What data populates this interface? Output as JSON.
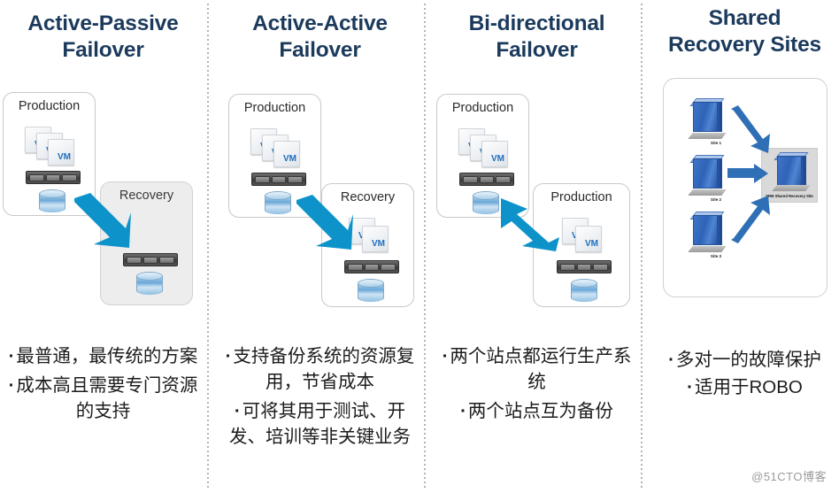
{
  "columns": [
    {
      "id": "active-passive",
      "title_line1": "Active-Passive",
      "title_line2": "Failover",
      "boxes": [
        {
          "label": "Production"
        },
        {
          "label": "Recovery"
        }
      ],
      "arrow": "single-down-right",
      "bullets": [
        "最普通，最传统的方案",
        "成本高且需要专门资源的支持"
      ]
    },
    {
      "id": "active-active",
      "title_line1": "Active-Active",
      "title_line2": "Failover",
      "boxes": [
        {
          "label": "Production"
        },
        {
          "label": "Recovery"
        }
      ],
      "arrow": "single-down-right",
      "bullets": [
        "支持备份系统的资源复用，节省成本",
        "可将其用于测试、开发、培训等非关键业务"
      ]
    },
    {
      "id": "bi-directional",
      "title_line1": "Bi-directional",
      "title_line2": "Failover",
      "boxes": [
        {
          "label": "Production"
        },
        {
          "label": "Production"
        }
      ],
      "arrow": "double-headed",
      "bullets": [
        "两个站点都运行生产系统",
        "两个站点互为备份"
      ]
    },
    {
      "id": "shared-recovery-sites",
      "title_line1": "Shared",
      "title_line2": "Recovery Sites",
      "sites": [
        {
          "label": "Site 1"
        },
        {
          "label": "Site 2"
        },
        {
          "label": "Site 3"
        }
      ],
      "target_label": "SRM Shared Recovery Site",
      "bullets": [
        "多对一的故障保护",
        "适用于ROBO"
      ]
    }
  ],
  "watermark": "@51CTO博客",
  "colors": {
    "heading": "#1b3a5c",
    "arrow_cyan": "#0d93ca",
    "arrow_blue": "#2f6fb5",
    "box_border": "#c9c9c9",
    "shaded_box": "#ededed",
    "vm_text": "#1e6fbf"
  }
}
